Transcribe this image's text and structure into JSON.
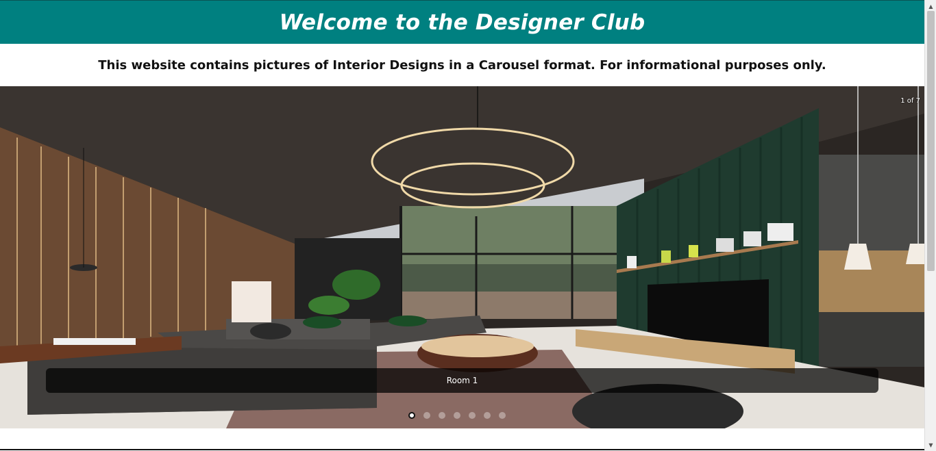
{
  "header": {
    "title": "Welcome to the Designer Club"
  },
  "subtitle": "This website contains pictures of Interior Designs in a Carousel format. For informational purposes only.",
  "carousel": {
    "counter": "1 of 7",
    "caption": "Room 1",
    "slide_count": 7,
    "active_index": 0
  },
  "colors": {
    "header_bg": "#008080",
    "header_text": "#ffffff"
  },
  "scrollbar": {
    "up_icon": "▲",
    "down_icon": "▼"
  }
}
